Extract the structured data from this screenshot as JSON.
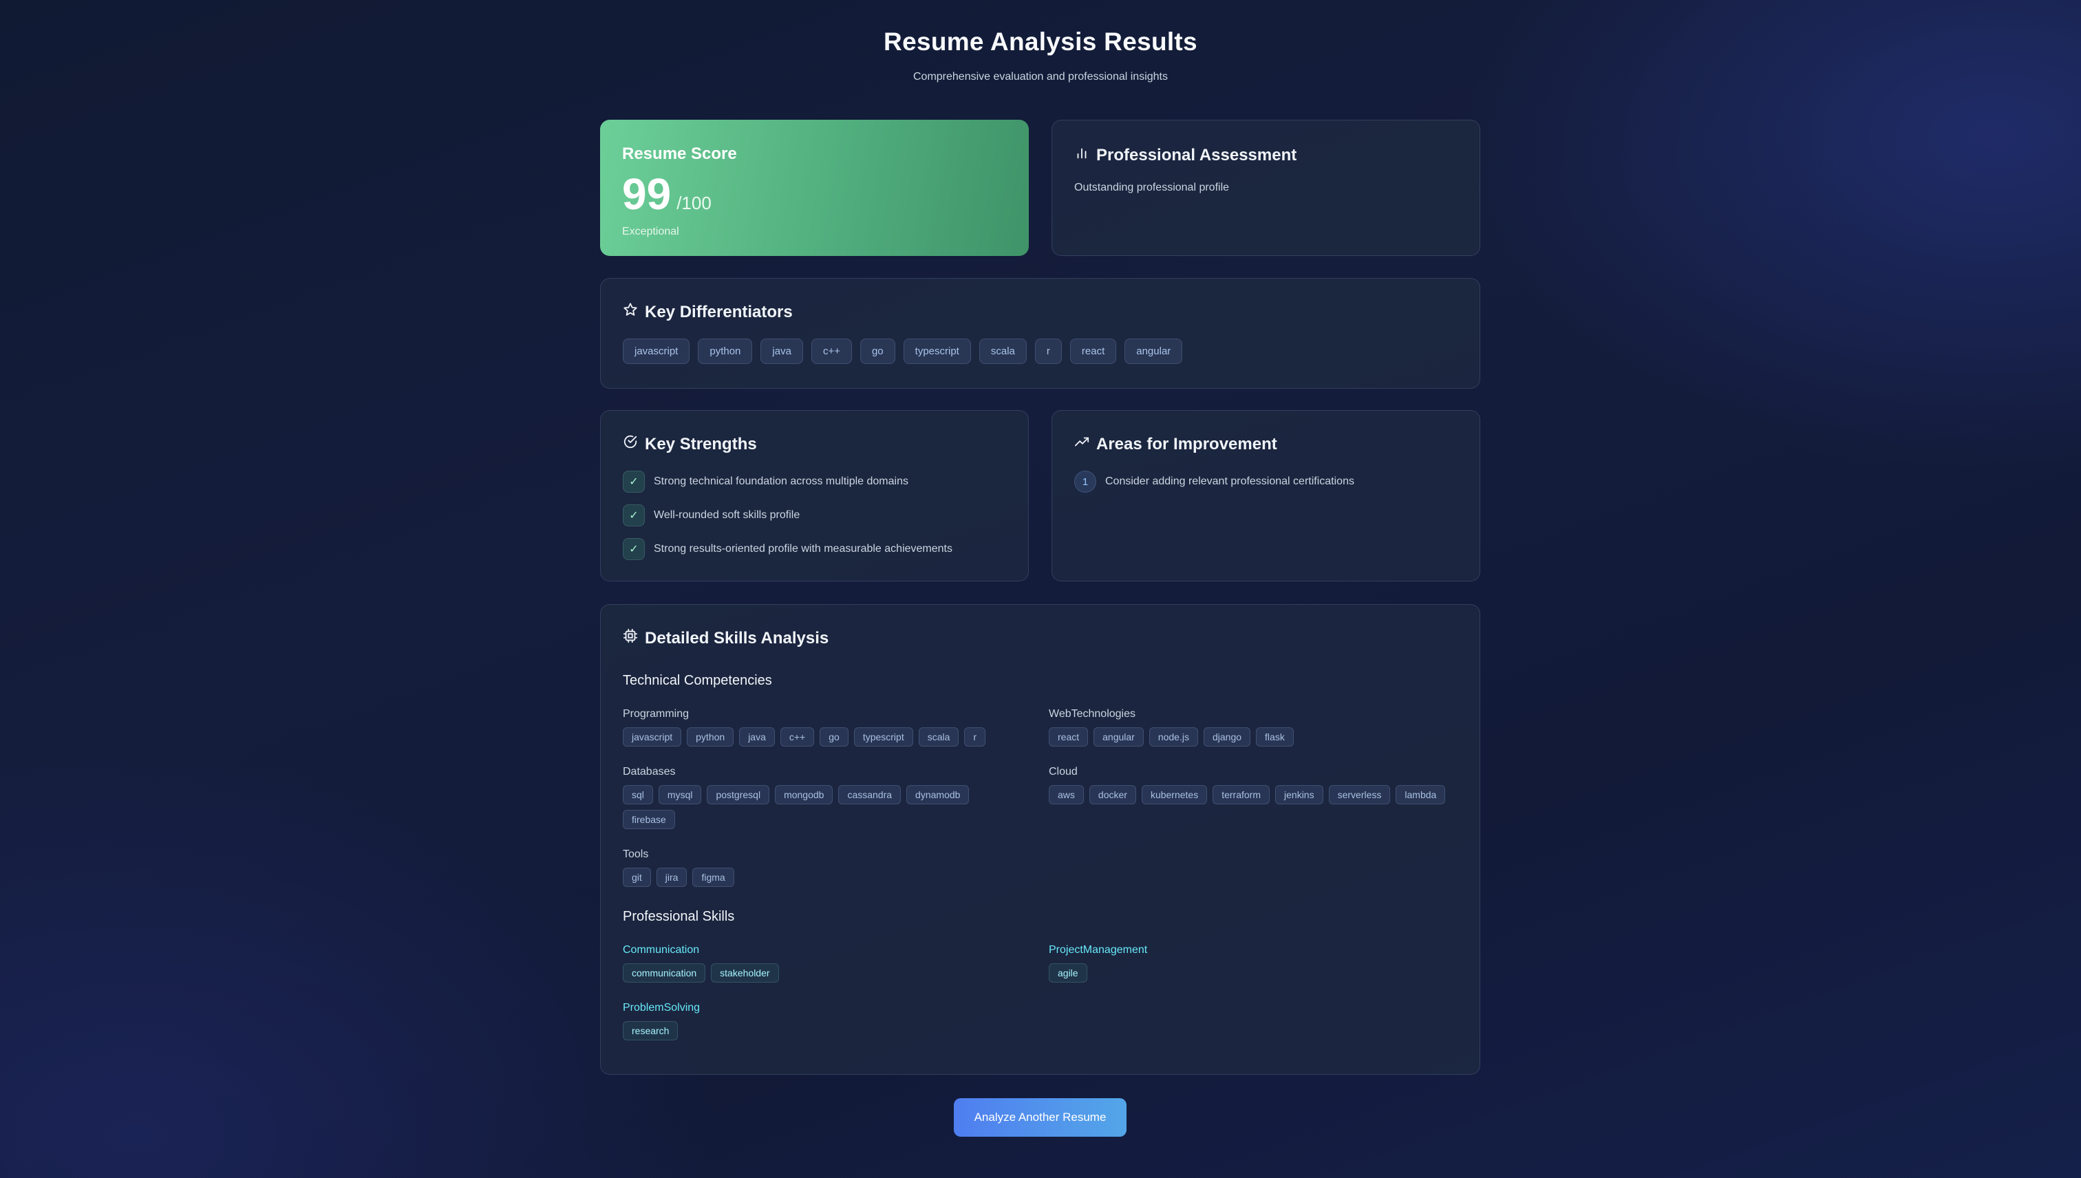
{
  "header": {
    "title": "Resume Analysis Results",
    "subtitle": "Comprehensive evaluation and professional insights"
  },
  "score": {
    "label": "Resume Score",
    "value": "99",
    "max": "/100",
    "rating": "Exceptional"
  },
  "assessment": {
    "title": "Professional Assessment",
    "text": "Outstanding professional profile"
  },
  "differentiators": {
    "title": "Key Differentiators",
    "items": [
      "javascript",
      "python",
      "java",
      "c++",
      "go",
      "typescript",
      "scala",
      "r",
      "react",
      "angular"
    ]
  },
  "strengths": {
    "title": "Key Strengths",
    "items": [
      "Strong technical foundation across multiple domains",
      "Well-rounded soft skills profile",
      "Strong results-oriented profile with measurable achievements"
    ]
  },
  "improvements": {
    "title": "Areas for Improvement",
    "items": [
      {
        "num": "1",
        "text": "Consider adding relevant professional certifications"
      }
    ]
  },
  "skills": {
    "title": "Detailed Skills Analysis",
    "technical": {
      "title": "Technical Competencies",
      "groups": [
        {
          "label": "Programming",
          "tags": [
            "javascript",
            "python",
            "java",
            "c++",
            "go",
            "typescript",
            "scala",
            "r"
          ]
        },
        {
          "label": "WebTechnologies",
          "tags": [
            "react",
            "angular",
            "node.js",
            "django",
            "flask"
          ]
        },
        {
          "label": "Databases",
          "tags": [
            "sql",
            "mysql",
            "postgresql",
            "mongodb",
            "cassandra",
            "dynamodb",
            "firebase"
          ]
        },
        {
          "label": "Cloud",
          "tags": [
            "aws",
            "docker",
            "kubernetes",
            "terraform",
            "jenkins",
            "serverless",
            "lambda"
          ]
        },
        {
          "label": "Tools",
          "tags": [
            "git",
            "jira",
            "figma"
          ]
        }
      ]
    },
    "professional": {
      "title": "Professional Skills",
      "groups": [
        {
          "label": "Communication",
          "tags": [
            "communication",
            "stakeholder"
          ]
        },
        {
          "label": "ProjectManagement",
          "tags": [
            "agile"
          ]
        },
        {
          "label": "ProblemSolving",
          "tags": [
            "research"
          ]
        }
      ]
    }
  },
  "actions": {
    "analyze_label": "Analyze Another Resume"
  },
  "icons": {
    "assessment": "bar-chart-icon",
    "differentiators": "star-icon",
    "strengths": "check-circle-icon",
    "improvements": "trending-up-icon",
    "skills": "cpu-icon",
    "strength_item": "check-icon"
  },
  "colors": {
    "score_gradient_start": "#6ccf98",
    "score_gradient_end": "#3f9468",
    "button_gradient_start": "#4f7ef0",
    "button_gradient_end": "#53a6e8",
    "accent_teal": "#67e8f9"
  }
}
